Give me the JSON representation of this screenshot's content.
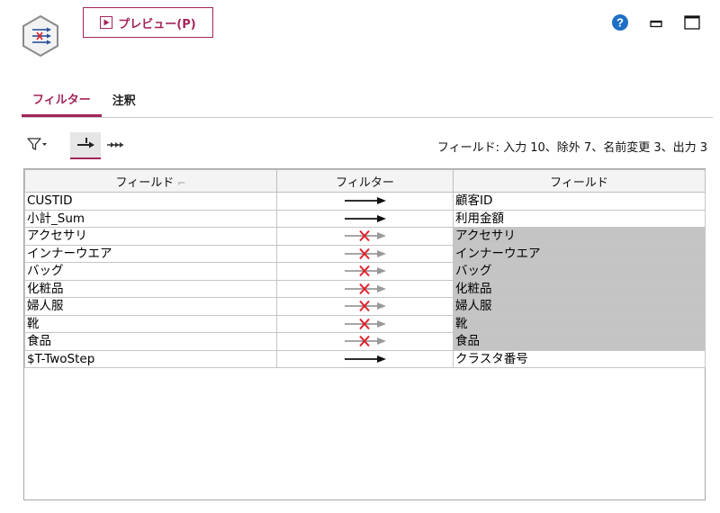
{
  "header": {
    "preview_label": "プレビュー(P)"
  },
  "icons": {
    "node": "filter-node-icon",
    "help": "help-icon",
    "minimize": "minimize-icon",
    "maximize": "maximize-icon",
    "filter_options": "filter-funnel-icon",
    "view_single": "single-arrow-view-icon",
    "view_multi": "multi-arrow-view-icon"
  },
  "tabs": [
    {
      "label": "フィルター",
      "active": true
    },
    {
      "label": "注釈",
      "active": false
    }
  ],
  "summary": "フィールド: 入力 10、除外 7、名前変更 3、出力 3",
  "table": {
    "headers": [
      "フィールド",
      "フィルター",
      "フィールド"
    ],
    "rows": [
      {
        "input": "CUSTID",
        "status": "pass",
        "output": "顧客ID"
      },
      {
        "input": "小計_Sum",
        "status": "pass",
        "output": "利用金額"
      },
      {
        "input": "アクセサリ",
        "status": "excluded",
        "output": "アクセサリ"
      },
      {
        "input": "インナーウエア",
        "status": "excluded",
        "output": "インナーウエア"
      },
      {
        "input": "バッグ",
        "status": "excluded",
        "output": "バッグ"
      },
      {
        "input": "化粧品",
        "status": "excluded",
        "output": "化粧品"
      },
      {
        "input": "婦人服",
        "status": "excluded",
        "output": "婦人服"
      },
      {
        "input": "靴",
        "status": "excluded",
        "output": "靴"
      },
      {
        "input": "食品",
        "status": "excluded",
        "output": "食品"
      },
      {
        "input": "$T-TwoStep",
        "status": "pass",
        "output": "クラスタ番号"
      }
    ]
  },
  "colors": {
    "accent": "#a3245a",
    "help_blue": "#1f6fc4",
    "excluded_bg": "#c4c4c4",
    "cross_red": "#e0202a"
  }
}
